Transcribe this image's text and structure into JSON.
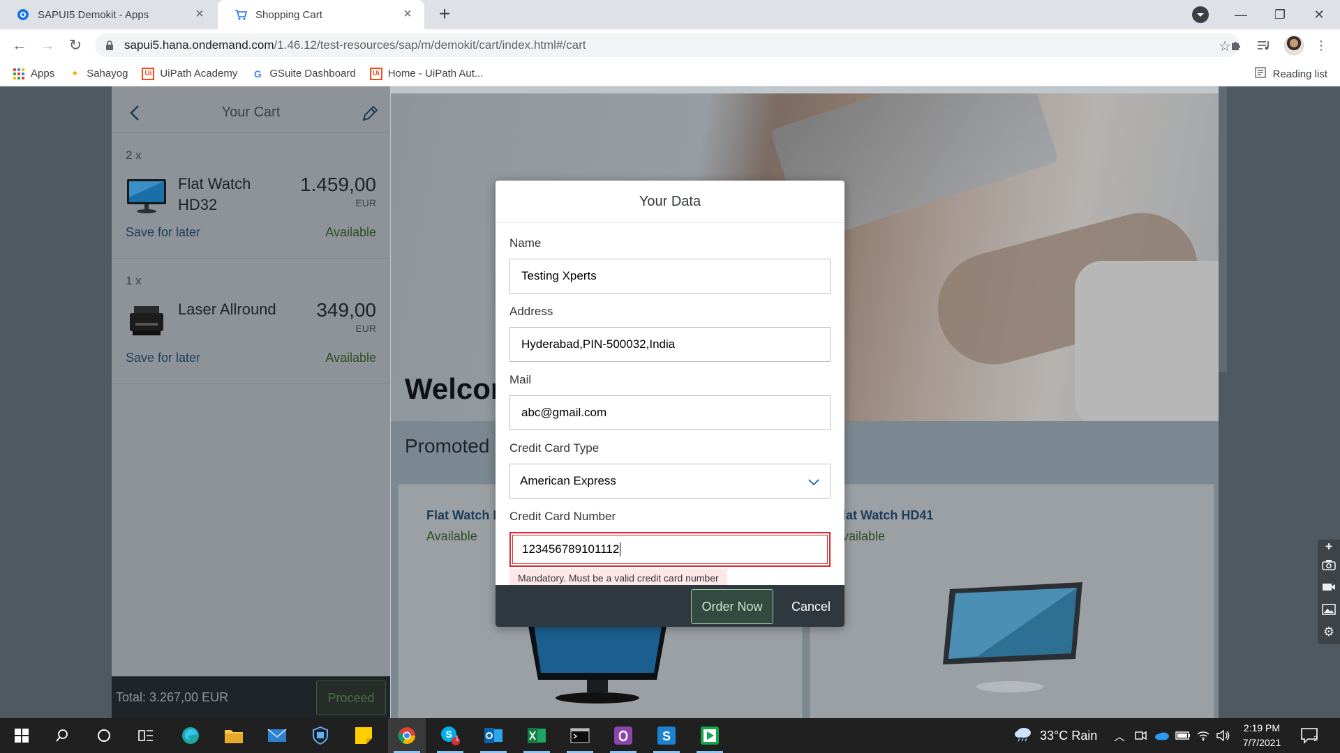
{
  "browser": {
    "tabs": [
      {
        "title": "SAPUI5 Demokit - Apps",
        "icon": "sapui5-favicon",
        "active": false
      },
      {
        "title": "Shopping Cart",
        "icon": "cart-favicon",
        "active": true
      }
    ],
    "url_host": "sapui5.hana.ondemand.com",
    "url_path": "/1.46.12/test-resources/sap/m/demokit/cart/index.html#/cart",
    "bookmarks": [
      {
        "label": "Apps",
        "icon": "apps-grid-icon"
      },
      {
        "label": "Sahayog",
        "icon": "sahayog-icon"
      },
      {
        "label": "UiPath Academy",
        "icon": "uipath-icon"
      },
      {
        "label": "GSuite Dashboard",
        "icon": "google-icon"
      },
      {
        "label": "Home - UiPath Aut...",
        "icon": "uipath-icon"
      }
    ],
    "reading_list": "Reading list"
  },
  "cart": {
    "title": "Your Cart",
    "items": [
      {
        "qty": "2 x",
        "name": "Flat Watch HD32",
        "price": "1.459,00",
        "currency": "EUR",
        "save_label": "Save for later",
        "status": "Available"
      },
      {
        "qty": "1 x",
        "name": "Laser Allround",
        "price": "349,00",
        "currency": "EUR",
        "save_label": "Save for later",
        "status": "Available"
      }
    ],
    "total": "Total: 3.267,00 EUR",
    "proceed": "Proceed"
  },
  "detail": {
    "welcome": "Welcom",
    "promoted": "Promoted",
    "promoted_items": [
      {
        "name": "Flat Watch H",
        "status": "Available"
      },
      {
        "name": "lat Watch HD41",
        "status": "vailable"
      }
    ]
  },
  "dialog": {
    "title": "Your Data",
    "name_label": "Name",
    "name_value": "Testing Xperts",
    "address_label": "Address",
    "address_value": "Hyderabad,PIN-500032,India",
    "mail_label": "Mail",
    "mail_value": "abc@gmail.com",
    "card_type_label": "Credit Card Type",
    "card_type_value": "American Express",
    "card_number_label": "Credit Card Number",
    "card_number_value": "123456789101112",
    "error_message": "Mandatory. Must be a valid credit card number",
    "order_now": "Order Now",
    "cancel": "Cancel"
  },
  "taskbar": {
    "weather": "33°C  Rain",
    "time": "2:19 PM",
    "date": "7/7/2021",
    "notification_count": "2",
    "skype_badge": "1"
  },
  "colors": {
    "accent_green": "#2f4d21",
    "link_blue": "#1c3f5c",
    "error_red": "#d9282e",
    "dialog_footer": "#2f383f"
  }
}
